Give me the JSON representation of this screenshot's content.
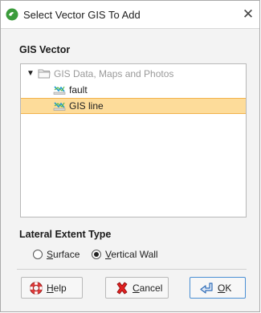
{
  "window": {
    "title": "Select Vector GIS To Add",
    "close_glyph": "✕",
    "app_icon": "leapfrog-app-icon"
  },
  "gis_vector": {
    "label": "GIS Vector",
    "tree": {
      "root": {
        "label": "GIS Data, Maps and Photos",
        "icon": "folder-icon",
        "expanded": true,
        "expander_glyph": "▼"
      },
      "items": [
        {
          "label": "fault",
          "icon": "gis-polyline-icon",
          "selected": false
        },
        {
          "label": "GIS line",
          "icon": "gis-polyline-icon",
          "selected": true
        }
      ]
    }
  },
  "lateral_extent": {
    "label": "Lateral Extent Type",
    "options": [
      {
        "mnemonic": "S",
        "rest": "urface",
        "checked": false
      },
      {
        "mnemonic": "V",
        "rest": "ertical Wall",
        "checked": true
      }
    ]
  },
  "buttons": {
    "help": {
      "mnemonic": "H",
      "rest": "elp",
      "icon": "lifebuoy-help-icon"
    },
    "cancel": {
      "mnemonic": "C",
      "rest": "ancel",
      "icon": "red-x-cancel-icon"
    },
    "ok": {
      "mnemonic": "O",
      "rest": "K",
      "icon": "enter-arrow-icon"
    }
  },
  "colors": {
    "selection_fill": "#fddc9a",
    "selection_border": "#f2b24b",
    "ok_border": "#4a8fd4",
    "dialog_bg": "#f3f3f3"
  }
}
